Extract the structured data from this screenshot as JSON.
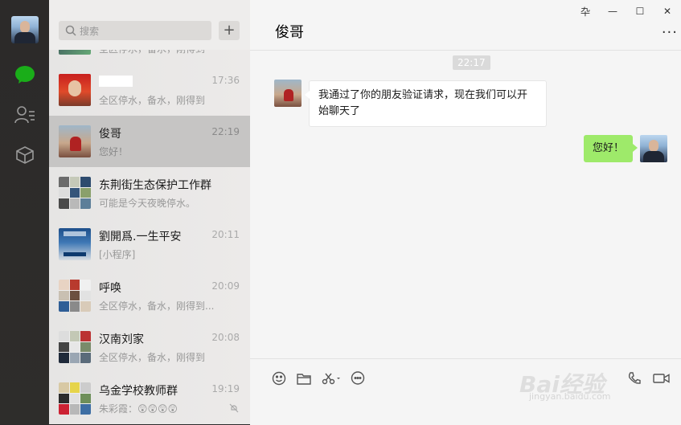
{
  "nav": {
    "icons": [
      "chat-icon",
      "contacts-icon",
      "collections-icon"
    ],
    "accent": "#1aad19"
  },
  "search": {
    "placeholder": "搜索",
    "add_label": "+"
  },
  "conversations": [
    {
      "name": "",
      "time": "",
      "preview": "全区停水，备水，刚得到"
    },
    {
      "name": "",
      "time": "17:36",
      "preview": "全区停水，备水，刚得到"
    },
    {
      "name": "俊哥",
      "time": "22:19",
      "preview": "您好！",
      "selected": true
    },
    {
      "name": "东荆街生态保护工作群",
      "time": "",
      "preview": "可能是今天夜晚停水。"
    },
    {
      "name": "劉開爲.一生平安",
      "time": "20:11",
      "preview": "[小程序]"
    },
    {
      "name": "呼唤",
      "time": "20:09",
      "preview": "全区停水，备水，刚得到..."
    },
    {
      "name": "汉南刘家",
      "time": "20:08",
      "preview": "全区停水，备水，刚得到"
    },
    {
      "name": "乌金学校教师群",
      "time": "19:19",
      "preview": "朱彩霞：😲😲😲😲"
    }
  ],
  "chat": {
    "title": "俊哥",
    "more": "···",
    "timestamp": "22:17",
    "incoming": "我通过了你的朋友验证请求，现在我们可以开始聊天了",
    "outgoing": "您好！",
    "window_controls": [
      "卆",
      "—",
      "☐",
      "✕"
    ]
  },
  "watermark": {
    "brand": "Bai经验",
    "url": "jingyan.baidu.com"
  },
  "colors": {
    "bubble_out": "#9eea6a",
    "selected_row": "#c6c5c4",
    "nav_bg": "#2c2a29"
  }
}
